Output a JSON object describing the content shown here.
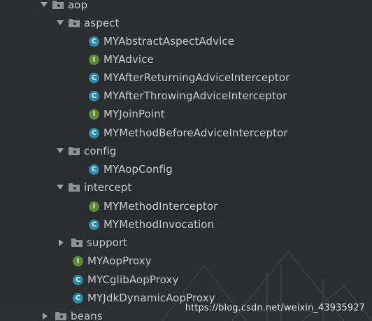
{
  "tree": {
    "nodes": [
      {
        "kind": "folder",
        "label": "aop",
        "icon": "folder-icon",
        "expanded": true
      },
      {
        "kind": "folder",
        "label": "aspect",
        "icon": "folder-icon",
        "expanded": true
      },
      {
        "kind": "class",
        "label": "MYAbstractAspectAdvice",
        "icon": "class-icon"
      },
      {
        "kind": "interface",
        "label": "MYAdvice",
        "icon": "interface-icon"
      },
      {
        "kind": "class",
        "label": "MYAfterReturningAdviceInterceptor",
        "icon": "class-icon"
      },
      {
        "kind": "class",
        "label": "MYAfterThrowingAdviceInterceptor",
        "icon": "class-icon"
      },
      {
        "kind": "interface",
        "label": "MYJoinPoint",
        "icon": "interface-icon"
      },
      {
        "kind": "class",
        "label": "MYMethodBeforeAdviceInterceptor",
        "icon": "class-icon"
      },
      {
        "kind": "folder",
        "label": "config",
        "icon": "folder-icon",
        "expanded": true
      },
      {
        "kind": "class",
        "label": "MYAopConfig",
        "icon": "class-icon"
      },
      {
        "kind": "folder",
        "label": "intercept",
        "icon": "folder-icon",
        "expanded": true
      },
      {
        "kind": "interface",
        "label": "MYMethodInterceptor",
        "icon": "interface-icon"
      },
      {
        "kind": "class",
        "label": "MYMethodInvocation",
        "icon": "class-icon"
      },
      {
        "kind": "folder",
        "label": "support",
        "icon": "folder-icon",
        "expanded": false
      },
      {
        "kind": "interface",
        "label": "MYAopProxy",
        "icon": "interface-icon"
      },
      {
        "kind": "class",
        "label": "MYCglibAopProxy",
        "icon": "class-icon"
      },
      {
        "kind": "class",
        "label": "MYJdkDynamicAopProxy",
        "icon": "class-icon"
      },
      {
        "kind": "folder",
        "label": "beans",
        "icon": "folder-icon",
        "expanded": false
      }
    ]
  },
  "badges": {
    "class_letter": "C",
    "interface_letter": "I"
  },
  "colors": {
    "background": "#2b2d30",
    "text": "#c9cccf",
    "class_badge": "#2f8aa6",
    "interface_badge": "#5d8b35",
    "folder": "#8d9196"
  },
  "watermark": {
    "text": "https://blog.csdn.net/weixin_43935927"
  }
}
